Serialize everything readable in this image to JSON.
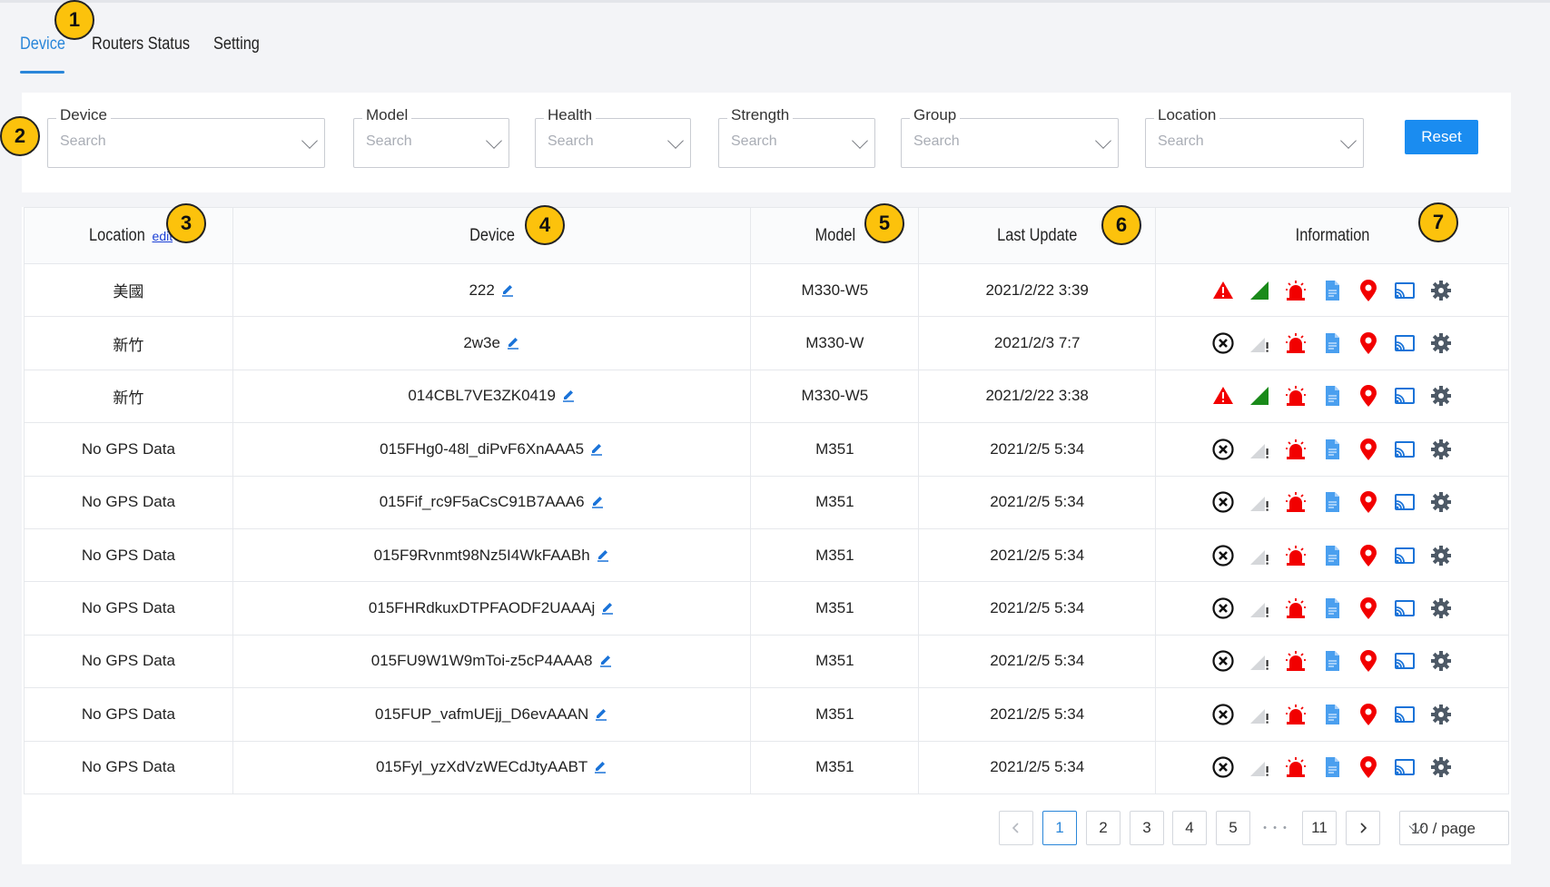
{
  "tabs": [
    {
      "label": "Device",
      "active": true
    },
    {
      "label": "Routers Status",
      "active": false
    },
    {
      "label": "Setting",
      "active": false
    }
  ],
  "filters": [
    {
      "label": "Device",
      "placeholder": "Search"
    },
    {
      "label": "Model",
      "placeholder": "Search"
    },
    {
      "label": "Health",
      "placeholder": "Search"
    },
    {
      "label": "Strength",
      "placeholder": "Search"
    },
    {
      "label": "Group",
      "placeholder": "Search"
    },
    {
      "label": "Location",
      "placeholder": "Search"
    }
  ],
  "reset_label": "Reset",
  "table": {
    "headers": {
      "location": "Location",
      "location_edit": "edit",
      "device": "Device",
      "model": "Model",
      "last_update": "Last Update",
      "information": "Information"
    },
    "rows": [
      {
        "location": "美國",
        "device": "222",
        "model": "M330-W5",
        "last_update": "2021/2/22 3:39",
        "health": "warning",
        "signal": "good"
      },
      {
        "location": "新竹",
        "device": "2w3e",
        "model": "M330-W",
        "last_update": "2021/2/3 7:7",
        "health": "offline",
        "signal": "none"
      },
      {
        "location": "新竹",
        "device": "014CBL7VE3ZK0419",
        "model": "M330-W5",
        "last_update": "2021/2/22 3:38",
        "health": "warning",
        "signal": "good"
      },
      {
        "location": "No GPS Data",
        "device": "015FHg0-48l_diPvF6XnAAA5",
        "model": "M351",
        "last_update": "2021/2/5 5:34",
        "health": "offline",
        "signal": "none"
      },
      {
        "location": "No GPS Data",
        "device": "015Fif_rc9F5aCsC91B7AAA6",
        "model": "M351",
        "last_update": "2021/2/5 5:34",
        "health": "offline",
        "signal": "none"
      },
      {
        "location": "No GPS Data",
        "device": "015F9Rvnmt98Nz5I4WkFAABh",
        "model": "M351",
        "last_update": "2021/2/5 5:34",
        "health": "offline",
        "signal": "none"
      },
      {
        "location": "No GPS Data",
        "device": "015FHRdkuxDTPFAODF2UAAAj",
        "model": "M351",
        "last_update": "2021/2/5 5:34",
        "health": "offline",
        "signal": "none"
      },
      {
        "location": "No GPS Data",
        "device": "015FU9W1W9mToi-z5cP4AAA8",
        "model": "M351",
        "last_update": "2021/2/5 5:34",
        "health": "offline",
        "signal": "none"
      },
      {
        "location": "No GPS Data",
        "device": "015FUP_vafmUEjj_D6evAAAN",
        "model": "M351",
        "last_update": "2021/2/5 5:34",
        "health": "offline",
        "signal": "none"
      },
      {
        "location": "No GPS Data",
        "device": "015Fyl_yzXdVzWECdJtyAABT",
        "model": "M351",
        "last_update": "2021/2/5 5:34",
        "health": "offline",
        "signal": "none"
      }
    ]
  },
  "info_icons": [
    "health-status-icon",
    "signal-strength-icon",
    "alarm-icon",
    "document-icon",
    "location-pin-icon",
    "cast-icon",
    "settings-gear-icon"
  ],
  "pagination": {
    "pages": [
      "1",
      "2",
      "3",
      "4",
      "5"
    ],
    "ellipsis": "• • •",
    "last_page": "11",
    "current": "1",
    "page_size": "10 / page"
  },
  "callouts": [
    "1",
    "2",
    "3",
    "4",
    "5",
    "6",
    "7"
  ],
  "colors": {
    "accent": "#2a86d9",
    "button": "#1a8cf0",
    "alarm": "#f20000",
    "signal_good": "#1a8a1a",
    "callout": "#fcc20c"
  }
}
